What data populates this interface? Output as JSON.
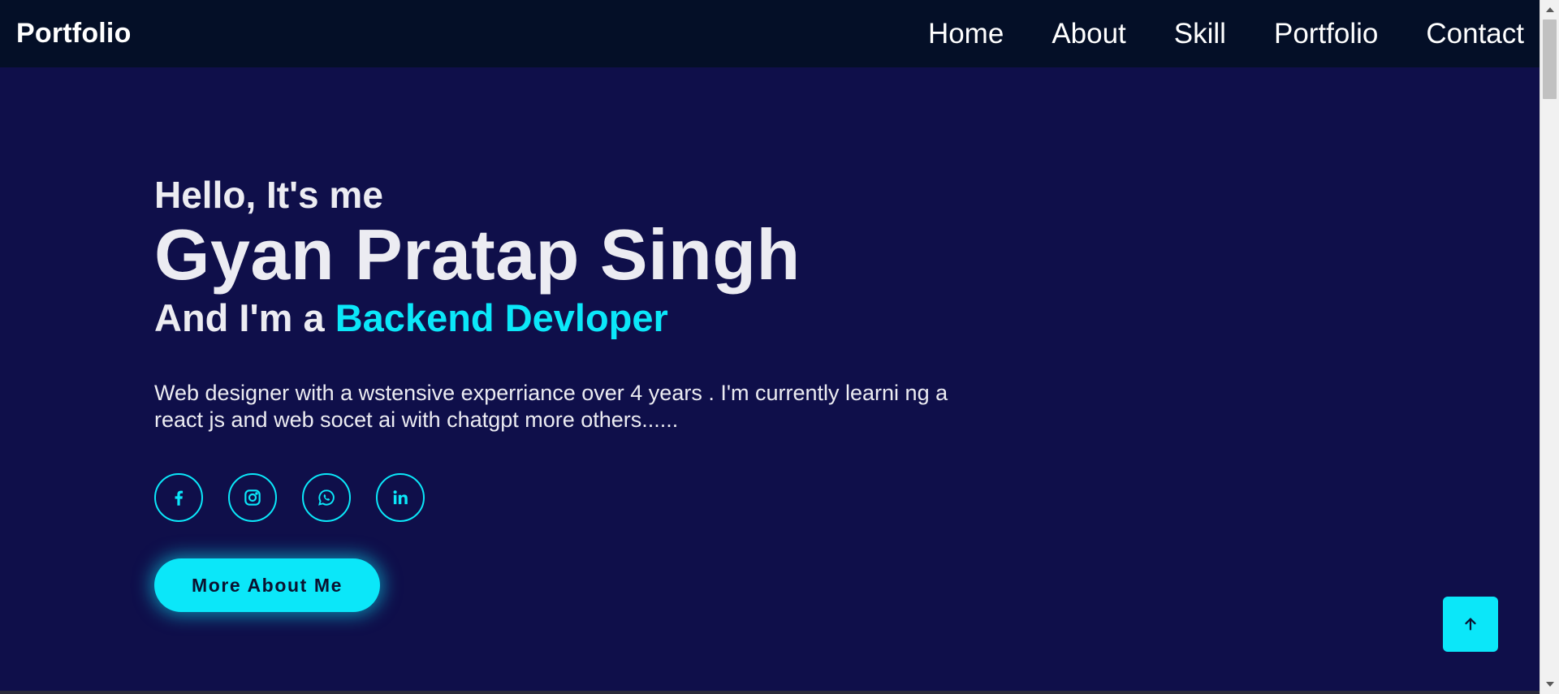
{
  "header": {
    "brand": "Portfolio",
    "nav": [
      {
        "label": "Home"
      },
      {
        "label": "About"
      },
      {
        "label": "Skill"
      },
      {
        "label": "Portfolio"
      },
      {
        "label": "Contact"
      }
    ]
  },
  "hero": {
    "greeting": "Hello, It's me",
    "name": "Gyan Pratap Singh",
    "role_prefix": "And I'm a",
    "role_highlight": "Backend Devloper",
    "description": "Web designer with a wstensive experriance over 4 years . I'm currently learni ng a react js and web socet ai with chatgpt more others......",
    "socials": [
      {
        "icon": "facebook-icon"
      },
      {
        "icon": "instagram-icon"
      },
      {
        "icon": "whatsapp-icon"
      },
      {
        "icon": "linkedin-icon"
      }
    ],
    "cta_label": "More About Me"
  },
  "scroll_top": {
    "icon": "arrow-up-icon"
  },
  "colors": {
    "background": "#0f0f4a",
    "navbar": "#040f27",
    "accent": "#0be7f9",
    "text": "#ececf2"
  }
}
